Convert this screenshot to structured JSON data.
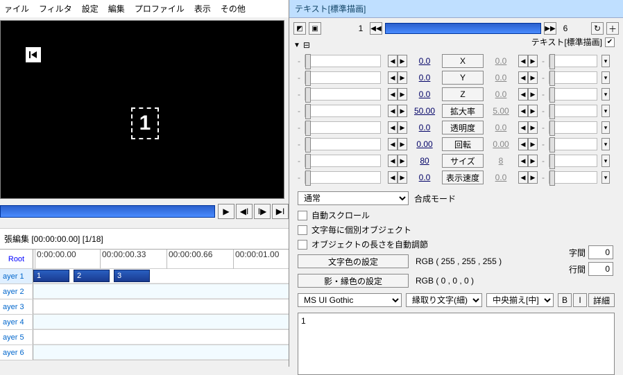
{
  "menu": [
    "ァイル",
    "フィルタ",
    "設定",
    "編集",
    "プロファイル",
    "表示",
    "その他"
  ],
  "preview": {
    "number": "1"
  },
  "timeline": {
    "title": "張編集 [00:00:00.00] [1/18]",
    "root": "Root",
    "ticks": [
      "0:00:00.00",
      "00:00:00.33",
      "00:00:00.66",
      "00:00:01.00"
    ],
    "layers": [
      "ayer 1",
      "ayer 2",
      "ayer 3",
      "ayer 4",
      "ayer 5",
      "ayer 6"
    ],
    "clips": [
      "1",
      "2",
      "3"
    ]
  },
  "panel": {
    "title": "テキスト[標準描画]",
    "frame_start": "1",
    "frame_end": "6",
    "section": "テキスト[標準描画]",
    "section_icon": "⊟",
    "params": [
      {
        "val": "0.0",
        "btn": "X",
        "rval": "0.0"
      },
      {
        "val": "0.0",
        "btn": "Y",
        "rval": "0.0"
      },
      {
        "val": "0.0",
        "btn": "Z",
        "rval": "0.0"
      },
      {
        "val": "50.00",
        "btn": "拡大率",
        "rval": "5.00"
      },
      {
        "val": "0.0",
        "btn": "透明度",
        "rval": "0.0"
      },
      {
        "val": "0.00",
        "btn": "回転",
        "rval": "0.00"
      },
      {
        "val": "80",
        "btn": "サイズ",
        "rval": "8"
      },
      {
        "val": "0.0",
        "btn": "表示速度",
        "rval": "0.0"
      }
    ],
    "compose_label": "合成モード",
    "compose_value": "通常",
    "check1": "自動スクロール",
    "check2": "文字毎に個別オブジェクト",
    "check3": "オブジェクトの長さを自動調節",
    "color1_btn": "文字色の設定",
    "color1_val": "RGB ( 255 , 255 , 255 )",
    "color2_btn": "影・縁色の設定",
    "color2_val": "RGB ( 0 , 0 , 0 )",
    "char_spacing_label": "字間",
    "char_spacing": "0",
    "line_spacing_label": "行間",
    "line_spacing": "0",
    "font": "MS UI Gothic",
    "style": "縁取り文字(細)",
    "align": "中央揃え[中]",
    "b": "B",
    "i": "I",
    "detail": "詳細",
    "text": "1"
  }
}
